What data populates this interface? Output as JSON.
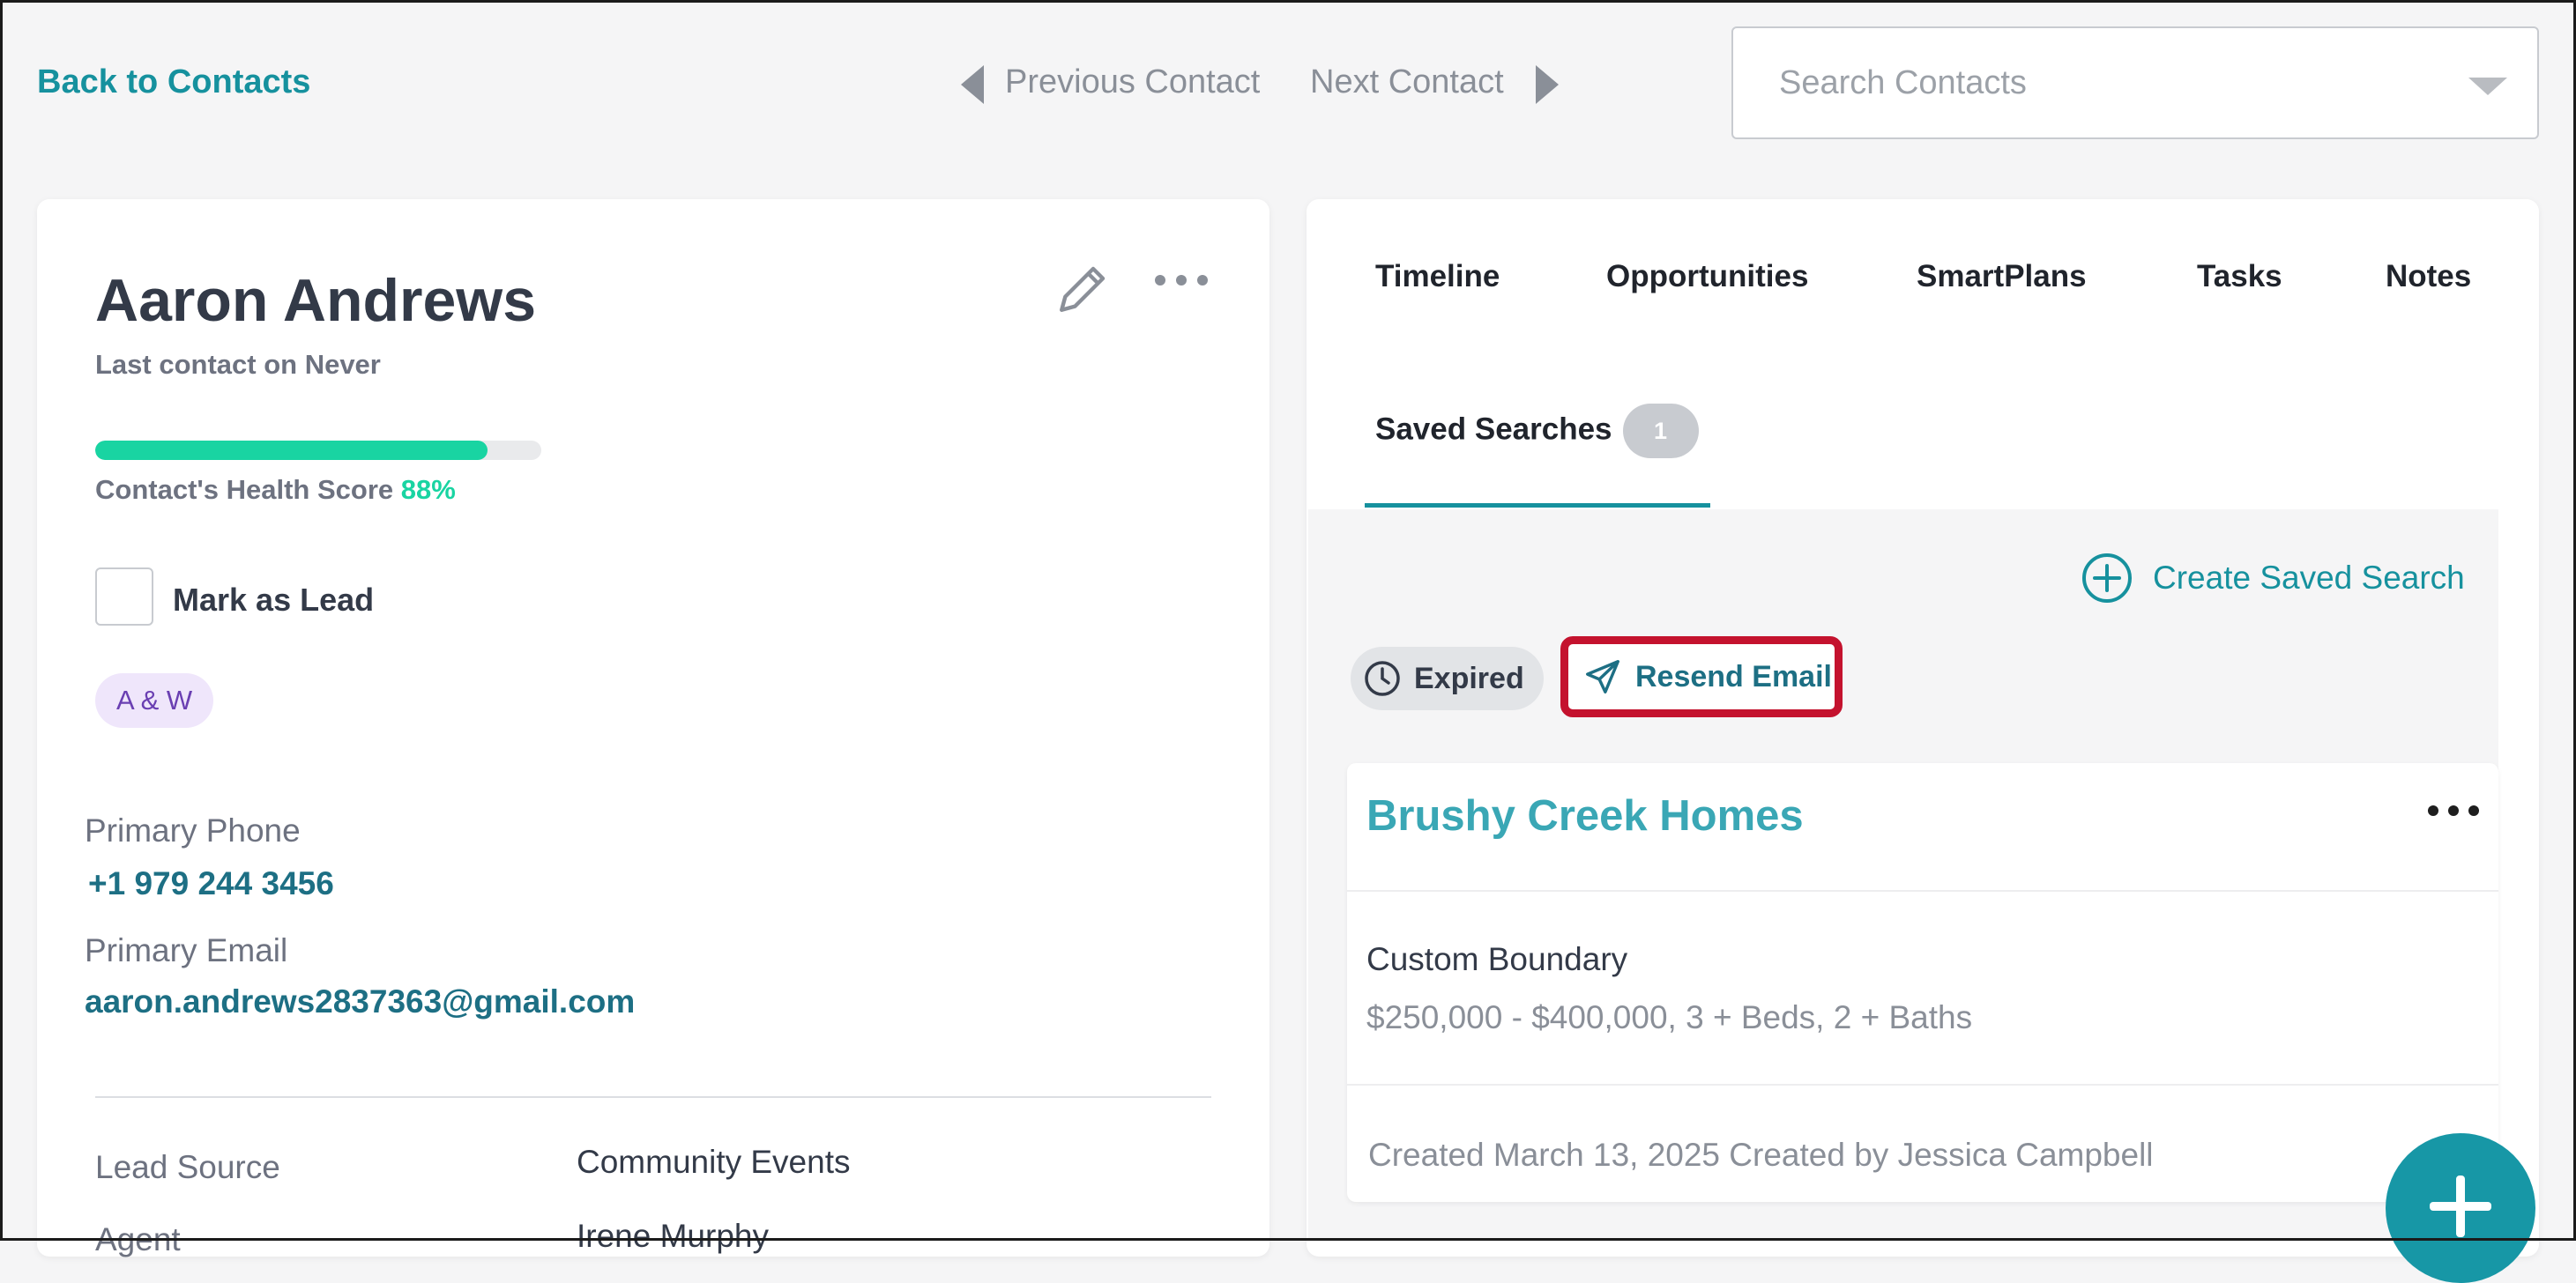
{
  "topbar": {
    "back_label": "Back to Contacts",
    "prev_label": "Previous Contact",
    "next_label": "Next Contact",
    "search_placeholder": "Search Contacts"
  },
  "contact": {
    "name": "Aaron Andrews",
    "last_contact": "Last contact on Never",
    "health_label": "Contact's Health Score",
    "health_value": "88%",
    "health_fraction": 0.88,
    "mark_as_lead_label": "Mark as Lead",
    "tag": "A & W",
    "phone_label": "Primary Phone",
    "phone": "+1 979 244 3456",
    "email_label": "Primary Email",
    "email": "aaron.andrews2837363@gmail.com",
    "lead_source_label": "Lead Source",
    "lead_source_value": "Community Events",
    "cut_label": "Agent",
    "cut_value": "Irene Murphy"
  },
  "tabs": {
    "timeline": "Timeline",
    "opportunities": "Opportunities",
    "smartplans": "SmartPlans",
    "tasks": "Tasks",
    "notes": "Notes",
    "saved_searches": "Saved Searches",
    "saved_searches_count": "1"
  },
  "saved_search": {
    "create_label": "Create Saved Search",
    "status": "Expired",
    "resend_label": "Resend Email",
    "title": "Brushy Creek Homes",
    "boundary": "Custom Boundary",
    "criteria": "$250,000 - $400,000, 3 + Beds, 2 + Baths",
    "created": "Created March 13, 2025 Created by Jessica Campbell"
  },
  "colors": {
    "accent": "#16919e",
    "health": "#19d4a2",
    "highlight": "#c4122e"
  }
}
